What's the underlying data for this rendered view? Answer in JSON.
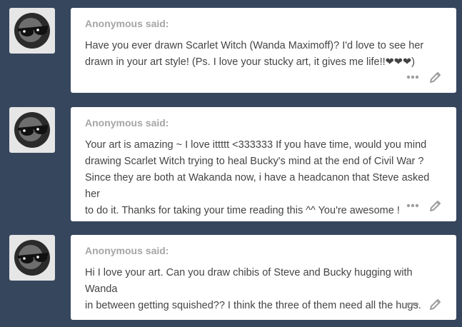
{
  "posts": [
    {
      "asker": "Anonymous said:",
      "lines": [
        "Have you ever drawn Scarlet Witch (Wanda Maximoff)? I'd love to see her",
        "drawn in your art style! (Ps. I love your stucky art, it gives me life!!❤❤❤)"
      ],
      "more_icon": "more-dots-icon",
      "edit_icon": "pencil-icon"
    },
    {
      "asker": "Anonymous said:",
      "lines": [
        "Your art is amazing ~ I love ittttt <333333 If you have time, would you mind",
        "drawing Scarlet Witch trying to heal Bucky's mind at the end of Civil War ?",
        "Since they are both at Wakanda now, i have a headcanon that Steve asked her",
        "to do it. Thanks for taking your time reading this ^^ You're awesome !"
      ],
      "more_icon": "more-dots-icon",
      "edit_icon": "pencil-icon"
    },
    {
      "asker": "Anonymous said:",
      "lines": [
        "Hi I love your art. Can you draw chibis of Steve and Bucky hugging with Wanda",
        "in between getting squished?? I think the three of them need all the hugs."
      ],
      "more_icon": "more-dots-icon",
      "edit_icon": "pencil-icon"
    }
  ],
  "avatar_icon": "anonymous-sunglasses-avatar-icon",
  "colors": {
    "background": "#36465d",
    "card": "#ffffff",
    "asker_text": "#a5a5a5",
    "body_text": "#444444",
    "icon": "#9e9e9e"
  }
}
